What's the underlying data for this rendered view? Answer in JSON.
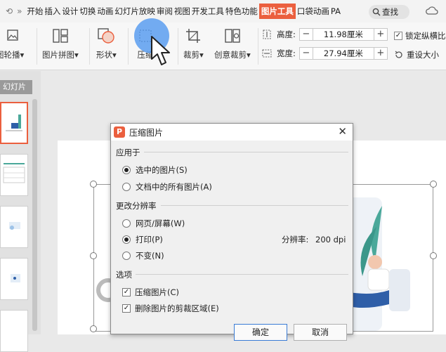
{
  "menubar": {
    "glyph_left": "⟲",
    "glyph_more": "»",
    "tabs": [
      "开始",
      "插入",
      "设计",
      "切换",
      "动画",
      "幻灯片放映",
      "审阅",
      "视图",
      "开发工具",
      "特色功能",
      "图片工具",
      "口袋动画",
      "PA"
    ],
    "active_tab": "图片工具",
    "search_label": "查找"
  },
  "toolbar": {
    "tools": [
      {
        "label": "图轮播",
        "caret": "▾"
      },
      {
        "label": "图片拼图",
        "caret": "▾"
      },
      {
        "label": "形状",
        "caret": "▾"
      },
      {
        "label": "压缩",
        "caret": ""
      },
      {
        "label": "裁剪",
        "caret": "▾"
      },
      {
        "label": "创意裁剪",
        "caret": "▾"
      }
    ],
    "height_label": "高度:",
    "height_value": "11.98厘米",
    "width_label": "宽度:",
    "width_value": "27.94厘米",
    "minus": "−",
    "plus": "+",
    "lock_ratio_label": "锁定纵横比",
    "reset_size_label": "重设大小"
  },
  "panel": {
    "tab_label": "幻灯片"
  },
  "dialog": {
    "title": "压缩图片",
    "close": "✕",
    "apply_to_header": "应用于",
    "apply_options": [
      {
        "label": "选中的图片(S)",
        "selected": true
      },
      {
        "label": "文档中的所有图片(A)",
        "selected": false
      }
    ],
    "resolution_header": "更改分辨率",
    "resolution_options": [
      {
        "label": "网页/屏幕(W)",
        "selected": false
      },
      {
        "label": "打印(P)",
        "selected": true
      },
      {
        "label": "不变(N)",
        "selected": false
      }
    ],
    "dpi_label": "分辨率:",
    "dpi_value": "200 dpi",
    "options_header": "选项",
    "checkboxes": [
      {
        "label": "压缩图片(C)",
        "checked": true
      },
      {
        "label": "删除图片的剪裁区域(E)",
        "checked": true
      }
    ],
    "ok_label": "确定",
    "cancel_label": "取消",
    "check_mark": "✓"
  },
  "colors": {
    "accent": "#eb5f3e",
    "highlight": "#5b9ef0",
    "illustration_green": "#4aa89a",
    "illustration_blue": "#2f5fa8"
  }
}
